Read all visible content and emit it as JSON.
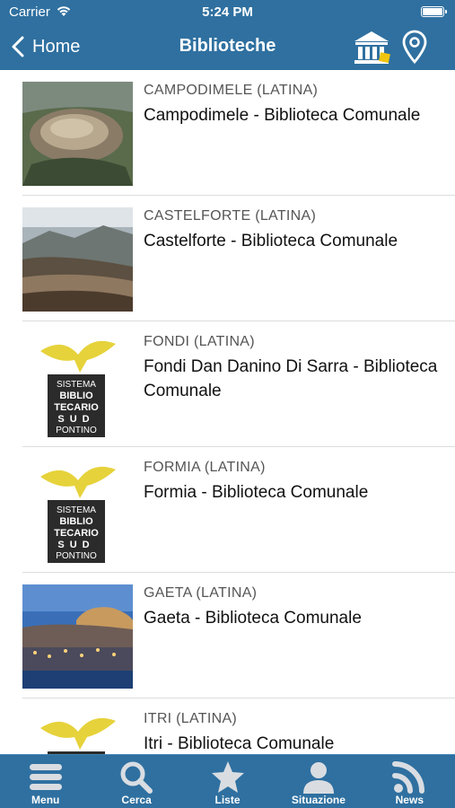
{
  "status_bar": {
    "carrier": "Carrier",
    "time": "5:24 PM"
  },
  "nav": {
    "back_label": "Home",
    "title": "Biblioteche"
  },
  "libraries": [
    {
      "city": "CAMPODIMELE (LATINA)",
      "name": "Campodimele - Biblioteca Comunale",
      "thumbnail": "photo-hilltop-town"
    },
    {
      "city": "CASTELFORTE (LATINA)",
      "name": "Castelforte - Biblioteca Comunale",
      "thumbnail": "photo-mountain-town"
    },
    {
      "city": "FONDI (LATINA)",
      "name": "Fondi Dan Danino Di Sarra - Biblioteca Comunale",
      "thumbnail": "logo-sistema-bibliotecario-sud-pontino"
    },
    {
      "city": "FORMIA (LATINA)",
      "name": "Formia - Biblioteca Comunale",
      "thumbnail": "logo-sistema-bibliotecario-sud-pontino"
    },
    {
      "city": "GAETA (LATINA)",
      "name": "Gaeta - Biblioteca Comunale",
      "thumbnail": "photo-coastal-town-night"
    },
    {
      "city": "ITRI (LATINA)",
      "name": "Itri - Biblioteca Comunale",
      "thumbnail": "logo-sistema-bibliotecario-sud-pontino"
    }
  ],
  "logo_text": [
    "SISTEMA",
    "BIBLIO",
    "TECARIO",
    "SUD",
    "PONTINO"
  ],
  "tabs": [
    {
      "label": "Menu",
      "icon": "menu-icon"
    },
    {
      "label": "Cerca",
      "icon": "search-icon"
    },
    {
      "label": "Liste",
      "icon": "star-icon"
    },
    {
      "label": "Situazione",
      "icon": "user-icon"
    },
    {
      "label": "News",
      "icon": "rss-icon"
    }
  ],
  "colors": {
    "bar": "#2f70a0",
    "text": "#111111",
    "subtext": "#555555",
    "separator": "#dcdcdc",
    "logo_bird": "#e6d23a"
  }
}
